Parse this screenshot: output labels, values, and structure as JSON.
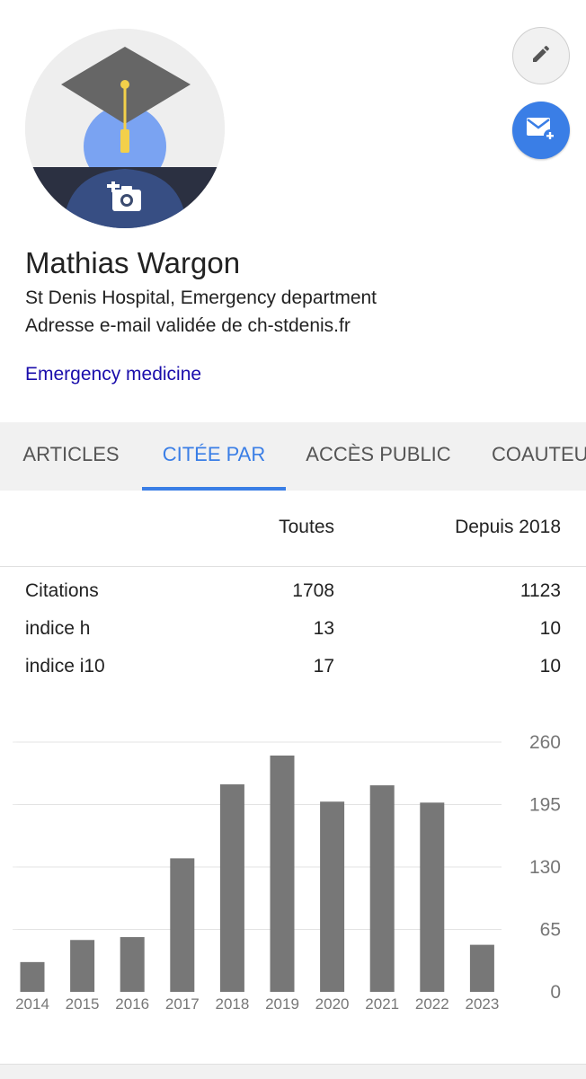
{
  "profile": {
    "name": "Mathias Wargon",
    "affiliation": "St Denis Hospital, Emergency department",
    "email_verification": "Adresse e-mail validée de ch-stdenis.fr",
    "interests": [
      "Emergency medicine"
    ]
  },
  "icons": {
    "edit": "pencil-icon",
    "follow": "mail-plus-icon",
    "avatar_camera": "add-photo-icon"
  },
  "colors": {
    "accent": "#3a7ee6",
    "link": "#1a0dab",
    "bar": "#777777",
    "cap": "#666666",
    "tassel": "#f3d04a"
  },
  "tabs": [
    {
      "label": "ARTICLES",
      "active": false
    },
    {
      "label": "CITÉE PAR",
      "active": true
    },
    {
      "label": "ACCÈS PUBLIC",
      "active": false
    },
    {
      "label": "COAUTEURS",
      "active": false
    }
  ],
  "stats": {
    "headers": [
      "",
      "Toutes",
      "Depuis 2018"
    ],
    "rows": [
      {
        "label": "Citations",
        "all": "1708",
        "since": "1123"
      },
      {
        "label": "indice h",
        "all": "13",
        "since": "10"
      },
      {
        "label": "indice i10",
        "all": "17",
        "since": "10"
      }
    ]
  },
  "chart_data": {
    "type": "bar",
    "categories": [
      "2014",
      "2015",
      "2016",
      "2017",
      "2018",
      "2019",
      "2020",
      "2021",
      "2022",
      "2023"
    ],
    "values": [
      31,
      54,
      57,
      139,
      216,
      246,
      198,
      215,
      197,
      49
    ],
    "ylim": [
      0,
      260
    ],
    "yticks": [
      0,
      65,
      130,
      195,
      260
    ],
    "grid": true,
    "y_axis_side": "right"
  }
}
